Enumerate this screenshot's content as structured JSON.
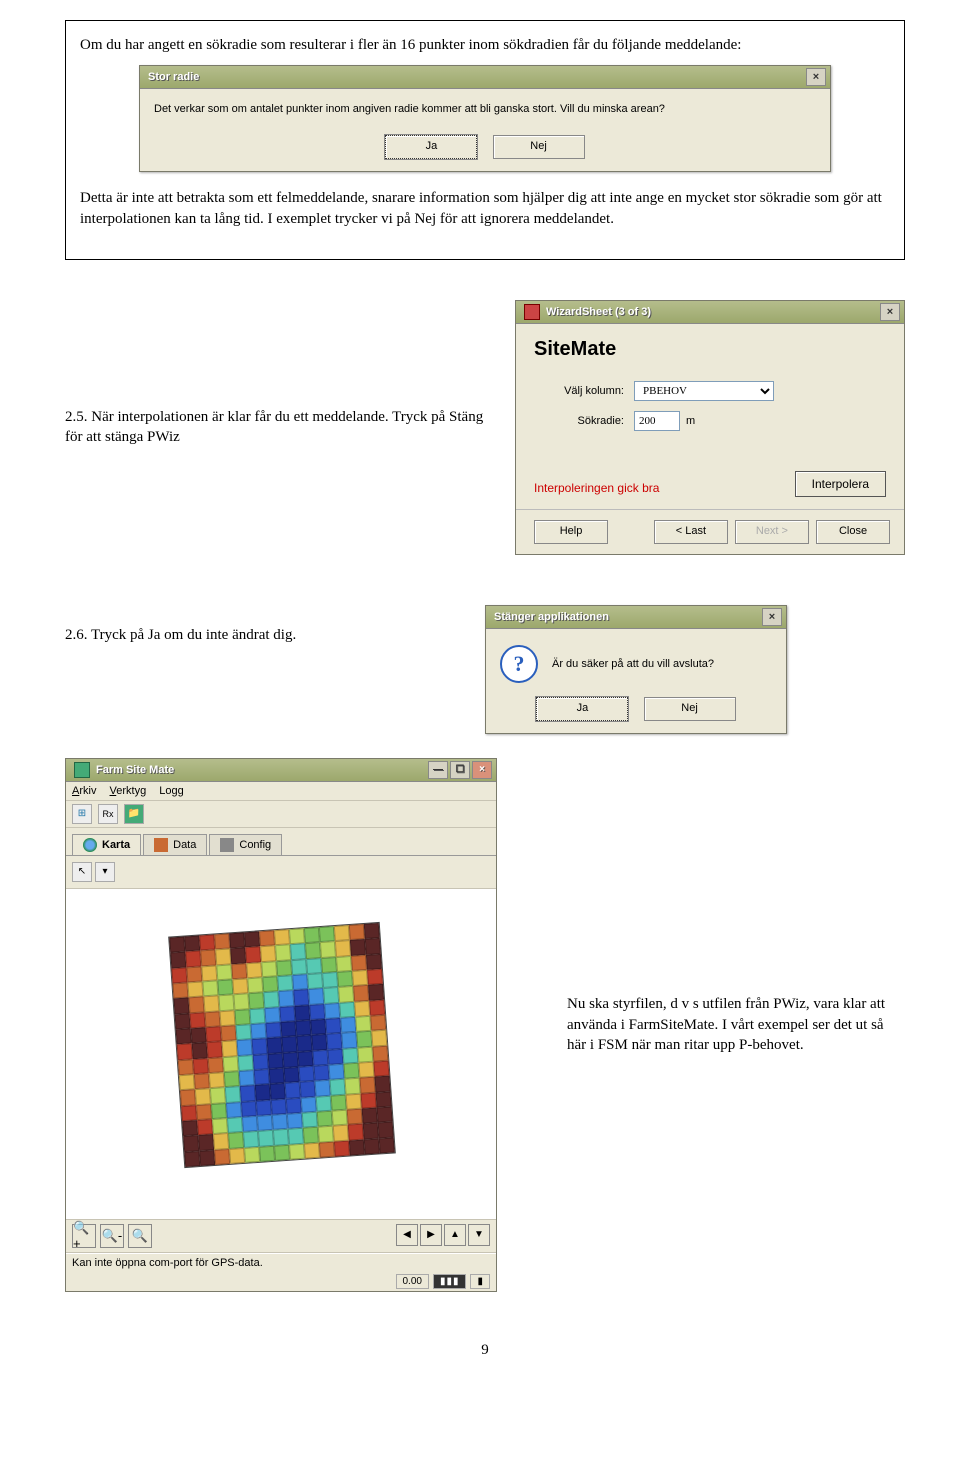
{
  "note": {
    "intro": "Om du har angett en sökradie som resulterar i fler än 16 punkter inom sökdradien får du följande meddelande:",
    "outro": "Detta är inte att betrakta som ett felmeddelande, snarare information som hjälper dig att inte ange en mycket stor sökradie som gör att interpolationen kan ta lång tid. I exemplet trycker vi på Nej för att ignorera meddelandet."
  },
  "stor_radie": {
    "title": "Stor radie",
    "message": "Det verkar som om antalet punkter inom angiven radie kommer att bli ganska stort. Vill du minska arean?",
    "yes": "Ja",
    "no": "Nej"
  },
  "s25": {
    "text": "2.5. När interpolationen är klar får du ett meddelande. Tryck på Stäng för att stänga PWiz"
  },
  "wizard": {
    "title": "WizardSheet (3 of 3)",
    "heading": "SiteMate",
    "col_label": "Välj kolumn:",
    "col_value": "PBEHOV",
    "radius_label": "Sökradie:",
    "radius_value": "200",
    "radius_unit": "m",
    "interp_btn": "Interpolera",
    "status": "Interpoleringen gick bra",
    "help": "Help",
    "last": "< Last",
    "next": "Next >",
    "close": "Close"
  },
  "s26": {
    "text": "2.6. Tryck på Ja om du inte ändrat dig."
  },
  "confirm": {
    "title": "Stänger applikationen",
    "message": "Är du säker på att du vill avsluta?",
    "yes": "Ja",
    "no": "Nej"
  },
  "fsm": {
    "title": "Farm Site Mate",
    "menu": {
      "arkiv": "Arkiv",
      "verktyg": "Verktyg",
      "logg": "Logg"
    },
    "tabs": {
      "karta": "Karta",
      "data": "Data",
      "config": "Config"
    },
    "status": "Kan inte öppna com-port för GPS-data.",
    "coord": "0.00"
  },
  "fsm_desc": "Nu ska styrfilen, d v s utfilen från PWiz, vara klar att använda i FarmSiteMate. I vårt exempel ser det ut så här i FSM när man ritar upp P-behovet.",
  "page_num": "9",
  "heatmap_colors": [
    "#5a2626",
    "#5a2626",
    "#bc3b2a",
    "#c96a33",
    "#5a2626",
    "#5a2626",
    "#c96a33",
    "#e3b94a",
    "#b9d85d",
    "#7bc25a",
    "#7bc25a",
    "#e3b94a",
    "#c96a33",
    "#5a2626",
    "#5a2626",
    "#bc3b2a",
    "#c96a33",
    "#e3b94a",
    "#5a2626",
    "#bc3b2a",
    "#e3b94a",
    "#b9d85d",
    "#56c9b3",
    "#7bc25a",
    "#b9d85d",
    "#e3b94a",
    "#5a2626",
    "#5a2626",
    "#bc3b2a",
    "#c96a33",
    "#e3b94a",
    "#b9d85d",
    "#c96a33",
    "#e3b94a",
    "#b9d85d",
    "#7bc25a",
    "#56c9b3",
    "#56c9b3",
    "#7bc25a",
    "#b9d85d",
    "#c96a33",
    "#5a2626",
    "#c96a33",
    "#e3b94a",
    "#b9d85d",
    "#7bc25a",
    "#e3b94a",
    "#b9d85d",
    "#7bc25a",
    "#56c9b3",
    "#3f8de0",
    "#56c9b3",
    "#56c9b3",
    "#7bc25a",
    "#e3b94a",
    "#bc3b2a",
    "#5a2626",
    "#c96a33",
    "#e3b94a",
    "#b9d85d",
    "#b9d85d",
    "#7bc25a",
    "#56c9b3",
    "#3f8de0",
    "#2a4cc0",
    "#3f8de0",
    "#56c9b3",
    "#b9d85d",
    "#c96a33",
    "#5a2626",
    "#5a2626",
    "#bc3b2a",
    "#c96a33",
    "#e3b94a",
    "#7bc25a",
    "#56c9b3",
    "#3f8de0",
    "#2a4cc0",
    "#1a2a8a",
    "#2a4cc0",
    "#3f8de0",
    "#56c9b3",
    "#e3b94a",
    "#bc3b2a",
    "#5a2626",
    "#5a2626",
    "#bc3b2a",
    "#c96a33",
    "#56c9b3",
    "#3f8de0",
    "#2a4cc0",
    "#1a2a8a",
    "#1a2a8a",
    "#1a2a8a",
    "#2a4cc0",
    "#3f8de0",
    "#b9d85d",
    "#c96a33",
    "#bc3b2a",
    "#5a2626",
    "#bc3b2a",
    "#e3b94a",
    "#3f8de0",
    "#2a4cc0",
    "#1a2a8a",
    "#1a2a8a",
    "#1a2a8a",
    "#1a2a8a",
    "#2a4cc0",
    "#3f8de0",
    "#7bc25a",
    "#e3b94a",
    "#c96a33",
    "#bc3b2a",
    "#c96a33",
    "#b9d85d",
    "#56c9b3",
    "#2a4cc0",
    "#1a2a8a",
    "#1a2a8a",
    "#1a2a8a",
    "#2a4cc0",
    "#2a4cc0",
    "#56c9b3",
    "#b9d85d",
    "#c96a33",
    "#e3b94a",
    "#c96a33",
    "#e3b94a",
    "#7bc25a",
    "#3f8de0",
    "#2a4cc0",
    "#1a2a8a",
    "#1a2a8a",
    "#2a4cc0",
    "#2a4cc0",
    "#3f8de0",
    "#7bc25a",
    "#e3b94a",
    "#bc3b2a",
    "#c96a33",
    "#e3b94a",
    "#b9d85d",
    "#56c9b3",
    "#2a4cc0",
    "#1a2a8a",
    "#1a2a8a",
    "#2a4cc0",
    "#2a4cc0",
    "#3f8de0",
    "#56c9b3",
    "#b9d85d",
    "#c96a33",
    "#5a2626",
    "#bc3b2a",
    "#c96a33",
    "#7bc25a",
    "#3f8de0",
    "#2a4cc0",
    "#2a4cc0",
    "#2a4cc0",
    "#2a4cc0",
    "#3f8de0",
    "#56c9b3",
    "#7bc25a",
    "#e3b94a",
    "#bc3b2a",
    "#5a2626",
    "#5a2626",
    "#bc3b2a",
    "#b9d85d",
    "#56c9b3",
    "#3f8de0",
    "#3f8de0",
    "#3f8de0",
    "#3f8de0",
    "#56c9b3",
    "#7bc25a",
    "#b9d85d",
    "#c96a33",
    "#5a2626",
    "#5a2626",
    "#5a2626",
    "#5a2626",
    "#e3b94a",
    "#7bc25a",
    "#56c9b3",
    "#56c9b3",
    "#56c9b3",
    "#56c9b3",
    "#7bc25a",
    "#b9d85d",
    "#e3b94a",
    "#bc3b2a",
    "#5a2626",
    "#5a2626",
    "#5a2626",
    "#5a2626",
    "#c96a33",
    "#e3b94a",
    "#b9d85d",
    "#7bc25a",
    "#7bc25a",
    "#b9d85d",
    "#e3b94a",
    "#c96a33",
    "#bc3b2a",
    "#5a2626",
    "#5a2626",
    "#5a2626"
  ]
}
